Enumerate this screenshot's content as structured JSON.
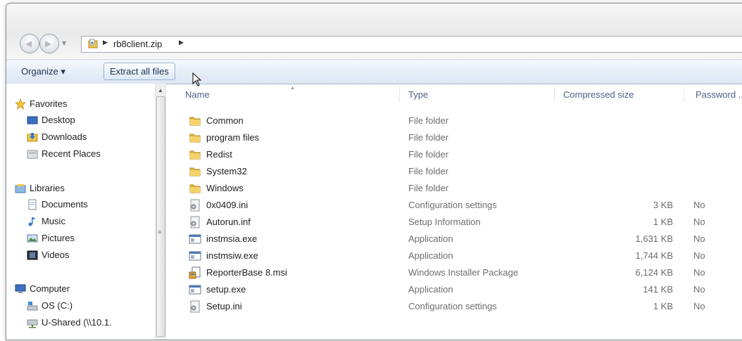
{
  "address": {
    "crumbs": [
      "rb8client.zip"
    ],
    "root_icon": "folder-user-icon"
  },
  "toolbar": {
    "organize_label": "Organize ▾",
    "extract_label": "Extract all files"
  },
  "nav": {
    "favorites": {
      "label": "Favorites",
      "icon": "star-icon",
      "items": [
        {
          "label": "Desktop",
          "icon": "desktop-icon"
        },
        {
          "label": "Downloads",
          "icon": "downloads-icon"
        },
        {
          "label": "Recent Places",
          "icon": "recent-places-icon"
        }
      ]
    },
    "libraries": {
      "label": "Libraries",
      "icon": "libraries-icon",
      "items": [
        {
          "label": "Documents",
          "icon": "documents-icon"
        },
        {
          "label": "Music",
          "icon": "music-icon"
        },
        {
          "label": "Pictures",
          "icon": "pictures-icon"
        },
        {
          "label": "Videos",
          "icon": "videos-icon"
        }
      ]
    },
    "computer": {
      "label": "Computer",
      "icon": "computer-icon",
      "items": [
        {
          "label": "OS (C:)",
          "icon": "drive-icon"
        },
        {
          "label": "U-Shared (\\\\10.1.",
          "icon": "network-drive-icon"
        }
      ]
    }
  },
  "columns": {
    "name": "Name",
    "type": "Type",
    "size": "Compressed size",
    "password": "Password ..."
  },
  "files": [
    {
      "name": "Common",
      "type": "File folder",
      "size": "",
      "password": "",
      "icon": "folder-icon"
    },
    {
      "name": "program files",
      "type": "File folder",
      "size": "",
      "password": "",
      "icon": "folder-icon"
    },
    {
      "name": "Redist",
      "type": "File folder",
      "size": "",
      "password": "",
      "icon": "folder-icon"
    },
    {
      "name": "System32",
      "type": "File folder",
      "size": "",
      "password": "",
      "icon": "folder-icon"
    },
    {
      "name": "Windows",
      "type": "File folder",
      "size": "",
      "password": "",
      "icon": "folder-icon"
    },
    {
      "name": "0x0409.ini",
      "type": "Configuration settings",
      "size": "3 KB",
      "password": "No",
      "icon": "settings-file-icon"
    },
    {
      "name": "Autorun.inf",
      "type": "Setup Information",
      "size": "1 KB",
      "password": "No",
      "icon": "settings-file-icon"
    },
    {
      "name": "instmsia.exe",
      "type": "Application",
      "size": "1,631 KB",
      "password": "No",
      "icon": "application-icon"
    },
    {
      "name": "instmsiw.exe",
      "type": "Application",
      "size": "1,744 KB",
      "password": "No",
      "icon": "application-icon"
    },
    {
      "name": "ReporterBase 8.msi",
      "type": "Windows Installer Package",
      "size": "6,124 KB",
      "password": "No",
      "icon": "installer-icon"
    },
    {
      "name": "setup.exe",
      "type": "Application",
      "size": "141 KB",
      "password": "No",
      "icon": "application-icon"
    },
    {
      "name": "Setup.ini",
      "type": "Configuration settings",
      "size": "1 KB",
      "password": "No",
      "icon": "settings-file-icon"
    }
  ]
}
